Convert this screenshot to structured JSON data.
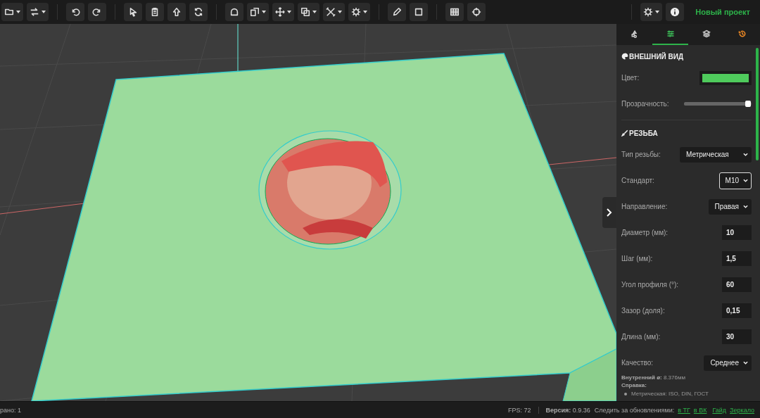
{
  "toolbar": {
    "groups": [
      [
        {
          "dropdown": true
        },
        {
          "dropdown": true
        }
      ],
      [
        {
          "dropdown": false
        },
        {
          "dropdown": false
        }
      ],
      [
        {
          "dropdown": false
        },
        {
          "dropdown": false
        },
        {
          "dropdown": false
        },
        {
          "dropdown": false
        }
      ],
      [
        {
          "dropdown": false
        },
        {
          "dropdown": true
        },
        {
          "dropdown": true
        },
        {
          "dropdown": true
        },
        {
          "dropdown": true
        },
        {
          "dropdown": true
        }
      ],
      [
        {
          "dropdown": false
        },
        {
          "dropdown": false
        }
      ],
      [
        {
          "dropdown": false
        },
        {
          "dropdown": false
        }
      ]
    ],
    "right_buttons": [
      {
        "dropdown": true
      },
      {
        "dropdown": false
      }
    ],
    "project_name": "Новый проект"
  },
  "panel": {
    "tabs": [
      {
        "selected": false
      },
      {
        "selected": true
      },
      {
        "selected": false
      },
      {
        "selected": false
      }
    ],
    "sections": [
      {
        "title": "ВНЕШНИЙ ВИД",
        "rows": [
          {
            "kind": "color",
            "label": "Цвет:",
            "color": "#4fcb5c"
          },
          {
            "kind": "slider",
            "label": "Прозрачность:",
            "level": 0.95
          }
        ]
      },
      {
        "title": "РЕЗЬБА",
        "rows": [
          {
            "kind": "select",
            "label": "Тип резьбы:",
            "value": "Метрическая",
            "focused": false,
            "wide": true
          },
          {
            "kind": "select",
            "label": "Стандарт:",
            "value": "M10",
            "focused": true,
            "wide": false
          },
          {
            "kind": "select",
            "label": "Направление:",
            "value": "Правая",
            "focused": false,
            "wide": false
          },
          {
            "kind": "input",
            "label": "Диаметр (мм):",
            "value": "10"
          },
          {
            "kind": "input",
            "label": "Шаг (мм):",
            "value": "1,5"
          },
          {
            "kind": "input",
            "label": "Угол профиля (°):",
            "value": "60"
          },
          {
            "kind": "input",
            "label": "Зазор (доля):",
            "value": "0,15"
          },
          {
            "kind": "input",
            "label": "Длина (мм):",
            "value": "30"
          },
          {
            "kind": "select",
            "label": "Качество:",
            "value": "Среднее",
            "focused": false,
            "wide": false
          }
        ]
      }
    ],
    "info": "**Внутренний ø:** 8.376мм",
    "help_title": "Справка:",
    "help_items": [
      "Метрическая: ISO, DIN, ГОСТ"
    ]
  },
  "status_bar": {
    "left": "рано: 1",
    "fps": "FPS: 72",
    "version": "**Версия:** 0.9.36",
    "follow": "Следить за обновлениями:",
    "links": [
      "в ТГ",
      "в ВК",
      "Гайд",
      "Зеркало"
    ]
  }
}
